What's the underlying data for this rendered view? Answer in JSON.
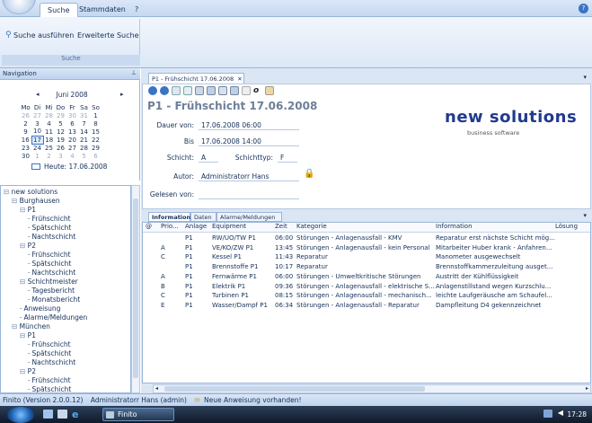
{
  "ribbon": {
    "tabs": [
      "Suche",
      "Stammdaten",
      "?"
    ],
    "buttons": [
      "Suche ausführen",
      "Erweiterte Suche"
    ],
    "group_label": "Suche"
  },
  "navigation": {
    "title": "Navigation"
  },
  "calendar": {
    "month": "Juni 2008",
    "weekdays": [
      "Mo",
      "Di",
      "Mi",
      "Do",
      "Fr",
      "Sa",
      "So"
    ],
    "weeks": [
      [
        "26",
        "27",
        "28",
        "29",
        "30",
        "31",
        "1"
      ],
      [
        "2",
        "3",
        "4",
        "5",
        "6",
        "7",
        "8"
      ],
      [
        "9",
        "10",
        "11",
        "12",
        "13",
        "14",
        "15"
      ],
      [
        "16",
        "17",
        "18",
        "19",
        "20",
        "21",
        "22"
      ],
      [
        "23",
        "24",
        "25",
        "26",
        "27",
        "28",
        "29"
      ],
      [
        "30",
        "1",
        "2",
        "3",
        "4",
        "5",
        "6"
      ]
    ],
    "today_label": "Heute: 17.06.2008",
    "selected_day": "17"
  },
  "tree": [
    {
      "label": "new solutions",
      "level": 0,
      "sign": "⊟"
    },
    {
      "label": "Burghausen",
      "level": 1,
      "sign": "⊟"
    },
    {
      "label": "P1",
      "level": 2,
      "sign": "⊟"
    },
    {
      "label": "Frühschicht",
      "level": 3,
      "sign": ""
    },
    {
      "label": "Spätschicht",
      "level": 3,
      "sign": ""
    },
    {
      "label": "Nachtschicht",
      "level": 3,
      "sign": ""
    },
    {
      "label": "P2",
      "level": 2,
      "sign": "⊟"
    },
    {
      "label": "Frühschicht",
      "level": 3,
      "sign": ""
    },
    {
      "label": "Spätschicht",
      "level": 3,
      "sign": ""
    },
    {
      "label": "Nachtschicht",
      "level": 3,
      "sign": ""
    },
    {
      "label": "Schichtmeister",
      "level": 2,
      "sign": "⊟"
    },
    {
      "label": "Tagesbericht",
      "level": 3,
      "sign": ""
    },
    {
      "label": "Monatsbericht",
      "level": 3,
      "sign": ""
    },
    {
      "label": "Anweisung",
      "level": 2,
      "sign": ""
    },
    {
      "label": "Alarme/Meldungen",
      "level": 2,
      "sign": ""
    },
    {
      "label": "München",
      "level": 1,
      "sign": "⊟"
    },
    {
      "label": "P1",
      "level": 2,
      "sign": "⊟"
    },
    {
      "label": "Frühschicht",
      "level": 3,
      "sign": ""
    },
    {
      "label": "Spätschicht",
      "level": 3,
      "sign": ""
    },
    {
      "label": "Nachtschicht",
      "level": 3,
      "sign": ""
    },
    {
      "label": "P2",
      "level": 2,
      "sign": "⊟"
    },
    {
      "label": "Frühschicht",
      "level": 3,
      "sign": ""
    },
    {
      "label": "Spätschicht",
      "level": 3,
      "sign": ""
    }
  ],
  "document": {
    "tab_title": "P1 - Frühschicht 17.06.2008",
    "title": "P1 - Frühschicht 17.06.2008",
    "fields": {
      "dauer_von_label": "Dauer von:",
      "dauer_von": "17.06.2008 06:00",
      "bis_label": "Bis",
      "bis": "17.06.2008 14:00",
      "schicht_label": "Schicht:",
      "schicht": "A",
      "schichttyp_label": "Schichttyp:",
      "schichttyp": "F",
      "autor_label": "Autor:",
      "autor": "Administratorr Hans",
      "gelesen_label": "Gelesen von:",
      "gelesen": ""
    },
    "logo": {
      "main": "new solutions",
      "sub": "business software"
    }
  },
  "grid": {
    "tabs": [
      "Information",
      "Daten",
      "Alarme/Meldungen"
    ],
    "headers": [
      "@",
      "Prio...",
      "Anlage",
      "Equipment",
      "Zeit",
      "Kategorie",
      "Information",
      "Lösung"
    ],
    "rows": [
      [
        "",
        "",
        "P1",
        "RW/UO/TW P1",
        "06:00",
        "Störungen - Anlagenausfall - KMV",
        "Reparatur erst nächste Schicht mög...",
        ""
      ],
      [
        "",
        "A",
        "P1",
        "VE/KO/ZW P1",
        "13:45",
        "Störungen - Anlagenausfall - kein Personal",
        "Mitarbeiter Huber krank - Anfahren...",
        ""
      ],
      [
        "",
        "C",
        "P1",
        "Kessel P1",
        "11:43",
        "Reparatur",
        "Manometer ausgewechselt",
        ""
      ],
      [
        "",
        "",
        "P1",
        "Brennstoffe P1",
        "10:17",
        "Reparatur",
        "Brennstoffkammerzuleitung ausget...",
        ""
      ],
      [
        "",
        "A",
        "P1",
        "Fernwärme P1",
        "06:00",
        "Störungen - Umweltkritische Störungen",
        "Austritt der Kühlflüssigkeit",
        ""
      ],
      [
        "",
        "B",
        "P1",
        "Elektrik P1",
        "09:36",
        "Störungen - Anlagenausfall - elektrische S...",
        "Anlagenstillstand wegen Kurzschlu...",
        ""
      ],
      [
        "",
        "C",
        "P1",
        "Turbinen P1",
        "08:15",
        "Störungen - Anlagenausfall - mechanisch...",
        "leichte Laufgeräusche am Schaufel...",
        ""
      ],
      [
        "",
        "E",
        "P1",
        "Wasser/Dampf P1",
        "06:34",
        "Störungen - Anlagenausfall - Reparatur",
        "Dampfleitung D4 gekennzeichnet",
        ""
      ]
    ]
  },
  "status": {
    "version": "Finito (Version 2.0.0.12)",
    "user": "Administratorr Hans (admin)",
    "message": "Neue Anweisung vorhanden!"
  },
  "taskbar": {
    "app": "Finito",
    "clock": "17:28"
  }
}
